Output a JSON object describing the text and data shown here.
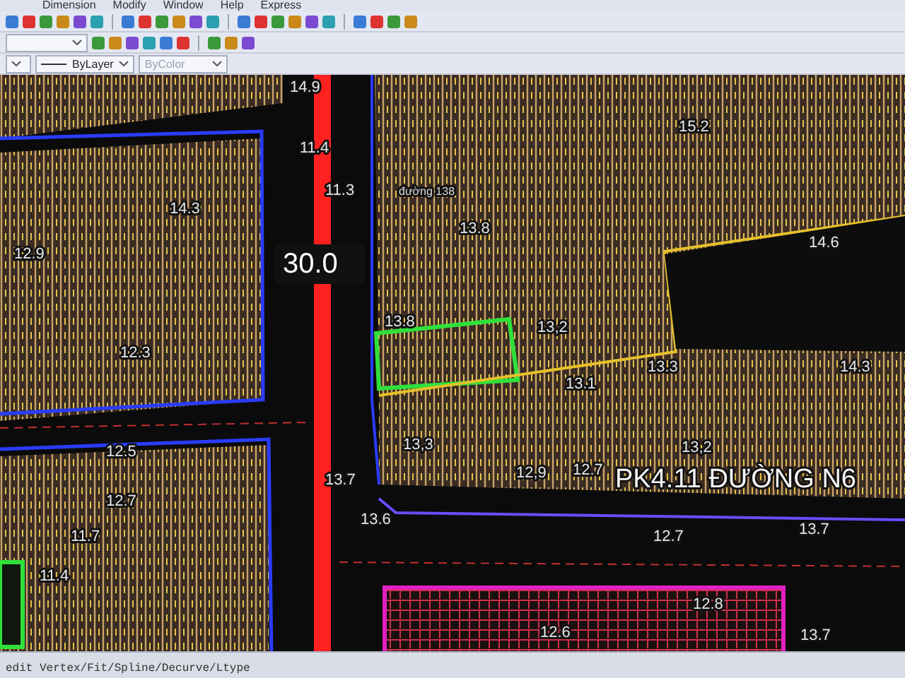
{
  "menu_bar": {
    "items": [
      "Dimension",
      "Modify",
      "Window",
      "Help",
      "Express"
    ]
  },
  "properties_bar": {
    "dropdowns": [
      {
        "value": "ByLayer",
        "disabled": false
      },
      {
        "value": "ByColor",
        "disabled": true
      }
    ]
  },
  "canvas": {
    "labels": [
      {
        "text": "14.9",
        "kind": "elevation"
      },
      {
        "text": "11.4",
        "kind": "elevation"
      },
      {
        "text": "11.3",
        "kind": "elevation"
      },
      {
        "text": "đường 138",
        "kind": "street"
      },
      {
        "text": "13.8",
        "kind": "elevation"
      },
      {
        "text": "15.2",
        "kind": "elevation"
      },
      {
        "text": "14.6",
        "kind": "elevation"
      },
      {
        "text": "14.3",
        "kind": "elevation"
      },
      {
        "text": "12.9",
        "kind": "elevation"
      },
      {
        "text": "12.3",
        "kind": "elevation"
      },
      {
        "text": "30.0",
        "kind": "dimension"
      },
      {
        "text": "13.8",
        "kind": "elevation"
      },
      {
        "text": "13,2",
        "kind": "elevation"
      },
      {
        "text": "13.1",
        "kind": "elevation"
      },
      {
        "text": "13.3",
        "kind": "elevation"
      },
      {
        "text": "14.3",
        "kind": "elevation"
      },
      {
        "text": "13,3",
        "kind": "elevation"
      },
      {
        "text": "13,2",
        "kind": "elevation"
      },
      {
        "text": "12,9",
        "kind": "elevation"
      },
      {
        "text": "12.7",
        "kind": "elevation"
      },
      {
        "text": "PK4.11 ĐƯỜNG N6",
        "kind": "title"
      },
      {
        "text": "12.5",
        "kind": "elevation"
      },
      {
        "text": "12.7",
        "kind": "elevation"
      },
      {
        "text": "11.7",
        "kind": "elevation"
      },
      {
        "text": "13.7",
        "kind": "elevation"
      },
      {
        "text": "13.6",
        "kind": "elevation"
      },
      {
        "text": "12.7",
        "kind": "elevation"
      },
      {
        "text": "13.7",
        "kind": "elevation"
      },
      {
        "text": "11.4",
        "kind": "elevation"
      },
      {
        "text": "12.8",
        "kind": "elevation"
      },
      {
        "text": "12.6",
        "kind": "elevation"
      },
      {
        "text": "13.7",
        "kind": "elevation"
      }
    ]
  },
  "command_line": {
    "text": "edit Vertex/Fit/Spline/Decurve/Ltype"
  }
}
